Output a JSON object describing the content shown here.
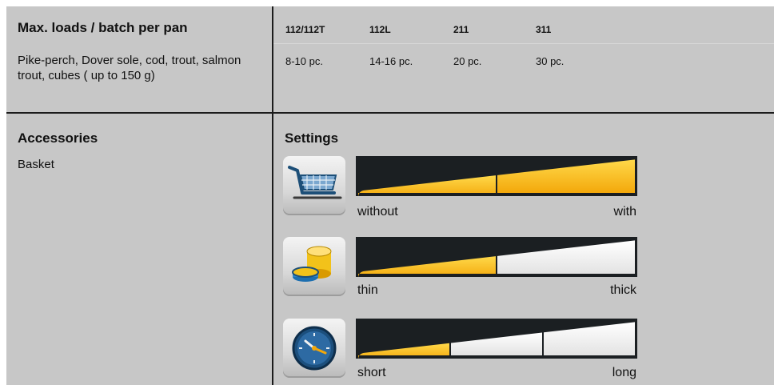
{
  "header": {
    "max_loads_title": "Max. loads / batch per pan",
    "models": [
      "112/112T",
      "112L",
      "211",
      "311"
    ],
    "food_text": "Pike-perch, Dover sole, cod, trout, salmon trout, cubes ( up to 150 g)",
    "counts": [
      "8-10 pc.",
      "14-16 pc.",
      "20 pc.",
      "30 pc."
    ]
  },
  "accessories": {
    "title": "Accessories",
    "item": "Basket"
  },
  "settings": {
    "title": "Settings",
    "rows": [
      {
        "icon": "basket-icon",
        "left_label": "without",
        "right_label": "with",
        "level": 2,
        "segments": 2
      },
      {
        "icon": "thickness-icon",
        "left_label": "thin",
        "right_label": "thick",
        "level": 1,
        "segments": 2
      },
      {
        "icon": "clock-icon",
        "left_label": "short",
        "right_label": "long",
        "level": 1,
        "segments": 3
      }
    ]
  },
  "colors": {
    "panel": "#c7c7c7",
    "dark": "#1b1f22",
    "active_top": "#ffd94a",
    "active_bottom": "#f3a80b",
    "inactive": "#e3e3e3"
  }
}
